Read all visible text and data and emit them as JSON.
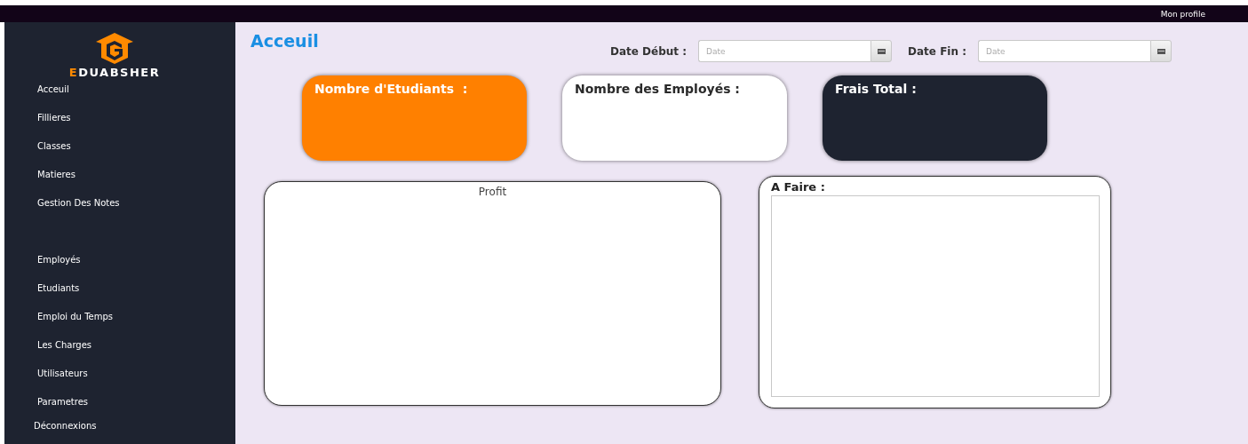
{
  "top_bar": {
    "profile_link": "Mon profile"
  },
  "sidebar": {
    "logo": "EDUABSHER",
    "groups": [
      [
        "Acceuil",
        "Fillieres",
        "Classes",
        "Matieres",
        "Gestion Des Notes"
      ],
      [
        "Employés",
        "Etudiants",
        "Emploi du Temps",
        "Les Charges",
        "Utilisateurs",
        "Parametres"
      ]
    ],
    "logout": "Déconnexions"
  },
  "page_title": "Acceuil",
  "date_filters": [
    {
      "label": "Date Début :",
      "placeholder": "Date"
    },
    {
      "label": "Date Fin :",
      "placeholder": "Date"
    }
  ],
  "stat_cards": [
    {
      "title": "Nombre d'Etudiants  :",
      "color": "#ff8000"
    },
    {
      "title": "Nombre des Employés :",
      "color": "#ffffff"
    },
    {
      "title": "Frais Total :",
      "color": "#1e2330"
    }
  ],
  "profit_panel": {
    "title": "Profit"
  },
  "todo_panel": {
    "title": "A Faire :"
  }
}
